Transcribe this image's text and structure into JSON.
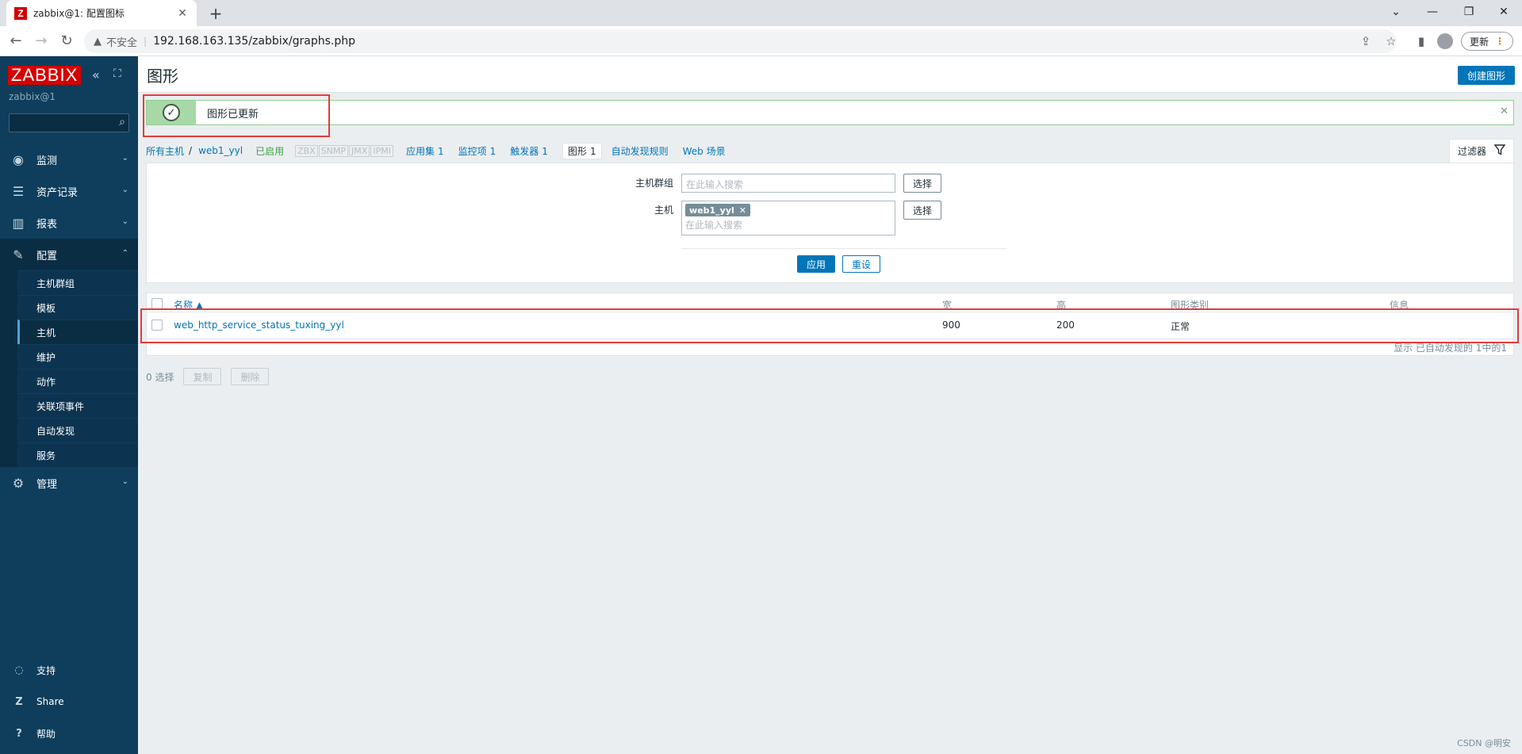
{
  "browser": {
    "tab_favicon": "Z",
    "tab_title": "zabbix@1: 配置图标",
    "tab_close": "✕",
    "new_tab": "+",
    "insecure_label": "不安全",
    "url": "192.168.163.135/zabbix/graphs.php",
    "update_label": "更新"
  },
  "sidebar": {
    "logo": "ZABBIX",
    "server_name": "zabbix@1",
    "menu": [
      {
        "label": "监测",
        "icon": "eye-icon"
      },
      {
        "label": "资产记录",
        "icon": "list-icon"
      },
      {
        "label": "报表",
        "icon": "chart-icon"
      },
      {
        "label": "配置",
        "icon": "wrench-icon"
      }
    ],
    "config_sub": [
      "主机群组",
      "模板",
      "主机",
      "维护",
      "动作",
      "关联项事件",
      "自动发现",
      "服务"
    ],
    "admin_label": "管理",
    "bottom": [
      {
        "label": "支持",
        "icon": "headset-icon"
      },
      {
        "label": "Share",
        "icon": "zabbix-share-icon"
      },
      {
        "label": "帮助",
        "icon": "help-icon"
      }
    ]
  },
  "header": {
    "title": "图形",
    "create_label": "创建图形"
  },
  "message": {
    "text": "图形已更新"
  },
  "navline": {
    "all_hosts": "所有主机",
    "sep": "/",
    "host": "web1_yyl",
    "status": "已启用",
    "tags": [
      "ZBX",
      "SNMP",
      "JMX",
      "IPMI"
    ],
    "items": [
      {
        "label": "应用集",
        "count": "1"
      },
      {
        "label": "监控项",
        "count": "1"
      },
      {
        "label": "触发器",
        "count": "1"
      },
      {
        "label": "图形",
        "count": "1"
      },
      {
        "label": "自动发现规则",
        "count": ""
      },
      {
        "label": "Web 场景",
        "count": ""
      }
    ]
  },
  "filter": {
    "tab_label": "过滤器",
    "host_group_label": "主机群组",
    "host_label": "主机",
    "search_placeholder": "在此输入搜索",
    "select_label": "选择",
    "chip": "web1_yyl",
    "apply_label": "应用",
    "reset_label": "重设"
  },
  "table": {
    "headers": {
      "name": "名称 ▲",
      "width": "宽",
      "height": "高",
      "graph_type": "图形类别",
      "info": "信息"
    },
    "rows": [
      {
        "name": "web_http_service_status_tuxing_yyl",
        "width": "900",
        "height": "200",
        "graph_type": "正常",
        "info": ""
      }
    ],
    "footer": "显示 已自动发现的 1中的1"
  },
  "actions": {
    "selected": "0 选择",
    "copy_label": "复制",
    "delete_label": "删除"
  },
  "watermark": "CSDN @明安",
  "colors": {
    "zabbix_red": "#d40000",
    "sidebar_bg": "#0e3e5c",
    "link_blue": "#0275b8",
    "success_green": "#a8d8a8",
    "highlight_red": "#e33b3b"
  }
}
